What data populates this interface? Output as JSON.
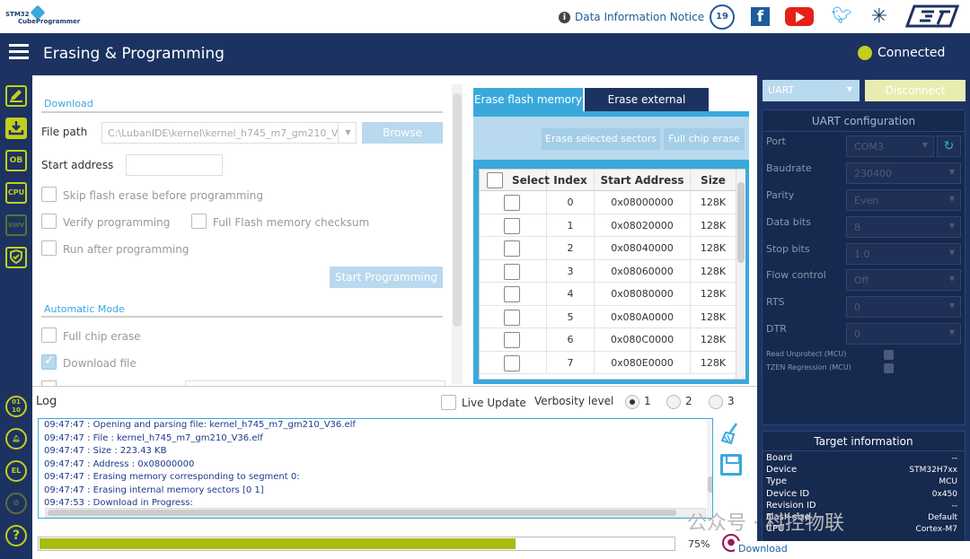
{
  "app": {
    "logo_line1": "STM32",
    "logo_line2": "CubeProgrammer",
    "data_notice": "Data Information Notice",
    "anniversary": "19",
    "header_title": "Erasing & Programming",
    "connection_status": "Connected"
  },
  "sidebar": {
    "items": [
      "OB",
      "CPU",
      "SWV"
    ],
    "bottom_items": [
      "01\n10",
      "BEL",
      "EL",
      "",
      "?"
    ]
  },
  "download": {
    "section_title": "Download",
    "file_path_label": "File path",
    "file_path_value": "C:\\LubanIDE\\kernel\\kernel_h745_m7_gm210_V",
    "browse_label": "Browse",
    "start_address_label": "Start address",
    "start_address_value": "",
    "skip_erase_label": "Skip flash erase before programming",
    "verify_label": "Verify programming",
    "full_checksum_label": "Full Flash memory checksum",
    "run_after_label": "Run after programming",
    "start_programming_label": "Start Programming",
    "auto_title": "Automatic Mode",
    "full_chip_erase_label": "Full chip erase",
    "download_file_label": "Download file"
  },
  "erase": {
    "tab_flash": "Erase flash memory",
    "tab_external": "Erase external memory",
    "erase_selected_label": "Erase selected sectors",
    "full_chip_erase_label": "Full chip erase",
    "columns": [
      "Select",
      "Index",
      "Start Address",
      "Size"
    ],
    "rows": [
      {
        "index": "0",
        "address": "0x08000000",
        "size": "128K"
      },
      {
        "index": "1",
        "address": "0x08020000",
        "size": "128K"
      },
      {
        "index": "2",
        "address": "0x08040000",
        "size": "128K"
      },
      {
        "index": "3",
        "address": "0x08060000",
        "size": "128K"
      },
      {
        "index": "4",
        "address": "0x08080000",
        "size": "128K"
      },
      {
        "index": "5",
        "address": "0x080A0000",
        "size": "128K"
      },
      {
        "index": "6",
        "address": "0x080C0000",
        "size": "128K"
      },
      {
        "index": "7",
        "address": "0x080E0000",
        "size": "128K"
      }
    ]
  },
  "uart": {
    "interface": "UART",
    "disconnect_label": "Disconnect",
    "config_title": "UART configuration",
    "port_label": "Port",
    "port_value": "COM3",
    "baudrate_label": "Baudrate",
    "baudrate_value": "230400",
    "parity_label": "Parity",
    "parity_value": "Even",
    "databits_label": "Data bits",
    "databits_value": "8",
    "stopbits_label": "Stop bits",
    "stopbits_value": "1.0",
    "flow_label": "Flow control",
    "flow_value": "Off",
    "rts_label": "RTS",
    "rts_value": "0",
    "dtr_label": "DTR",
    "dtr_value": "0",
    "unprotect_label": "Read Unprotect (MCU)",
    "tzen_label": "TZEN Regression (MCU)"
  },
  "target": {
    "title": "Target information",
    "board_label": "Board",
    "board_value": "--",
    "device_label": "Device",
    "device_value": "STM32H7xx",
    "type_label": "Type",
    "type_value": "MCU",
    "deviceid_label": "Device ID",
    "deviceid_value": "0x450",
    "revision_label": "Revision ID",
    "revision_value": "--",
    "flash_label": "Flash size",
    "flash_value": "Default",
    "cpu_label": "CPU",
    "cpu_value": "Cortex-M7"
  },
  "log": {
    "title": "Log",
    "live_update_label": "Live Update",
    "verbosity_label": "Verbosity level",
    "levels": [
      "1",
      "2",
      "3"
    ],
    "lines": [
      "09:47:47 : Opening and parsing file: kernel_h745_m7_gm210_V36.elf",
      "09:47:47 :   File          : kernel_h745_m7_gm210_V36.elf",
      "09:47:47 :   Size          : 223.43 KB",
      "09:47:47 :   Address       : 0x08000000",
      "09:47:47 : Erasing memory corresponding to segment 0:",
      "09:47:47 : Erasing internal memory sectors [0 1]",
      "09:47:53 : Download in Progress:"
    ],
    "progress": 75,
    "progress_label": "75%",
    "status_label": "Download"
  },
  "watermark": "公众号 · 科控物联",
  "colors": {
    "navy": "#1c3361",
    "accent_blue": "#39a9dc",
    "light_blue": "#b8d9ee",
    "lime": "#c2cf1e",
    "progress": "#a8bc10"
  }
}
